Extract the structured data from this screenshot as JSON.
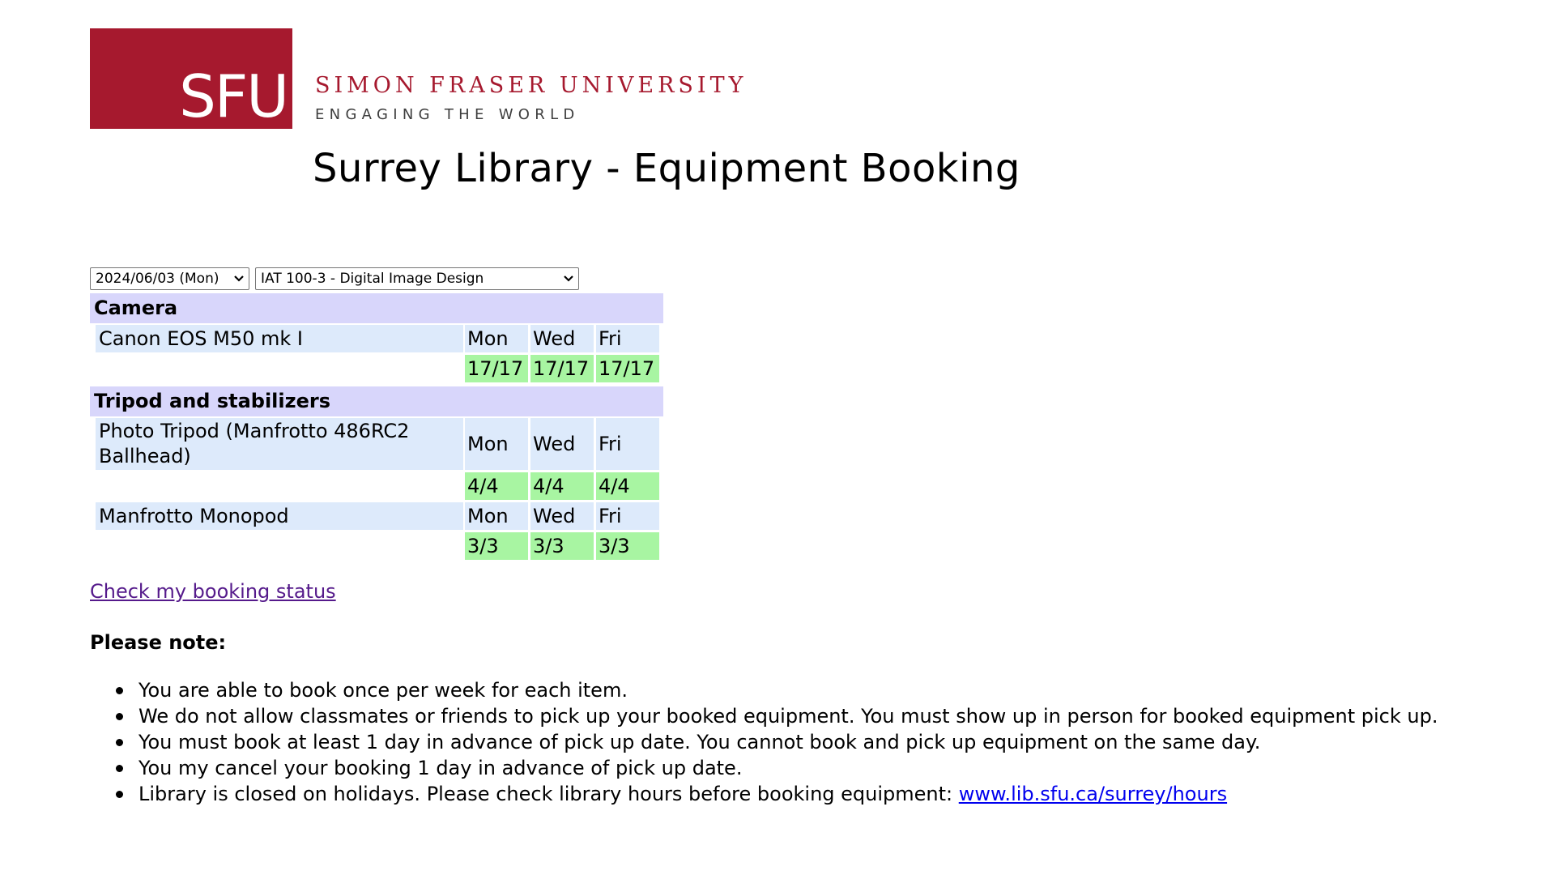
{
  "header": {
    "logo_text": "SFU",
    "university_name": "SIMON FRASER UNIVERSITY",
    "tagline": "ENGAGING THE WORLD",
    "page_title": "Surrey Library - Equipment Booking"
  },
  "colors": {
    "brand_red": "#a6192e",
    "category_bg": "#d8d6fb",
    "item_bg": "#ddeafb",
    "available_bg": "#a8f5a2",
    "visited_link": "#551a8b",
    "link": "#0000ee"
  },
  "controls": {
    "date_select": {
      "selected": "2024/06/03 (Mon)"
    },
    "course_select": {
      "selected": "IAT 100-3 - Digital Image Design"
    }
  },
  "categories": [
    {
      "name": "Camera",
      "items": [
        {
          "name": "Canon EOS M50 mk I",
          "days": [
            "Mon",
            "Wed",
            "Fri"
          ],
          "availability": [
            "17/17",
            "17/17",
            "17/17"
          ]
        }
      ]
    },
    {
      "name": "Tripod and stabilizers",
      "items": [
        {
          "name_line1": "Photo Tripod (Manfrotto 486RC2",
          "name_line2": "Ballhead)",
          "days": [
            "Mon",
            "Wed",
            "Fri"
          ],
          "availability": [
            "4/4",
            "4/4",
            "4/4"
          ]
        },
        {
          "name": "Manfrotto Monopod",
          "days": [
            "Mon",
            "Wed",
            "Fri"
          ],
          "availability": [
            "3/3",
            "3/3",
            "3/3"
          ]
        }
      ]
    }
  ],
  "links": {
    "check_status": "Check my booking status"
  },
  "notes": {
    "heading": "Please note:",
    "items": [
      "You are able to book once per week for each item.",
      "We do not allow classmates or friends to pick up your booked equipment. You must show up in person for booked equipment pick up.",
      "You must book at least 1 day in advance of pick up date. You cannot book and pick up equipment on the same day.",
      "You my cancel your booking 1 day in advance of pick up date.",
      "Library is closed on holidays. Please check library hours before booking equipment: "
    ],
    "hours_link": "www.lib.sfu.ca/surrey/hours"
  }
}
